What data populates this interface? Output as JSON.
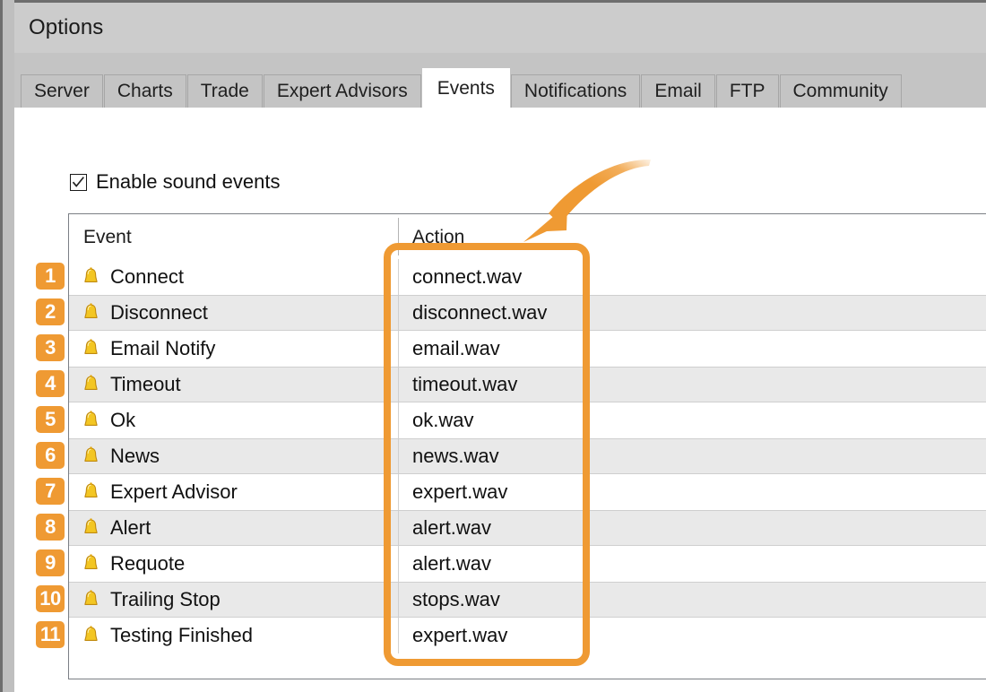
{
  "window": {
    "title": "Options"
  },
  "tabs": [
    {
      "label": "Server",
      "active": false
    },
    {
      "label": "Charts",
      "active": false
    },
    {
      "label": "Trade",
      "active": false
    },
    {
      "label": "Expert Advisors",
      "active": false
    },
    {
      "label": "Events",
      "active": true
    },
    {
      "label": "Notifications",
      "active": false
    },
    {
      "label": "Email",
      "active": false
    },
    {
      "label": "FTP",
      "active": false
    },
    {
      "label": "Community",
      "active": false
    }
  ],
  "events_page": {
    "enable_sound_events": {
      "label": "Enable sound events",
      "checked": true,
      "icon": "checkmark-icon"
    },
    "table": {
      "columns": [
        "Event",
        "Action"
      ],
      "rows": [
        {
          "num": "1",
          "icon": "bell-icon",
          "event": "Connect",
          "action": "connect.wav"
        },
        {
          "num": "2",
          "icon": "bell-icon",
          "event": "Disconnect",
          "action": "disconnect.wav"
        },
        {
          "num": "3",
          "icon": "bell-icon",
          "event": "Email Notify",
          "action": "email.wav"
        },
        {
          "num": "4",
          "icon": "bell-icon",
          "event": "Timeout",
          "action": "timeout.wav"
        },
        {
          "num": "5",
          "icon": "bell-icon",
          "event": "Ok",
          "action": "ok.wav"
        },
        {
          "num": "6",
          "icon": "bell-icon",
          "event": "News",
          "action": "news.wav"
        },
        {
          "num": "7",
          "icon": "bell-icon",
          "event": "Expert Advisor",
          "action": "expert.wav"
        },
        {
          "num": "8",
          "icon": "bell-icon",
          "event": "Alert",
          "action": "alert.wav"
        },
        {
          "num": "9",
          "icon": "bell-icon",
          "event": "Requote",
          "action": "alert.wav"
        },
        {
          "num": "10",
          "icon": "bell-icon",
          "event": "Trailing Stop",
          "action": "stops.wav"
        },
        {
          "num": "11",
          "icon": "bell-icon",
          "event": "Testing Finished",
          "action": "expert.wav"
        }
      ]
    }
  },
  "annotations": {
    "accent_color": "#ef9a33",
    "highlight_rect": {
      "target": "action-column"
    },
    "arrow": {
      "points_to": "action-column-top"
    }
  },
  "colors": {
    "accent": "#ef9a33",
    "titlebar": "#cccccc",
    "tabstrip": "#c4c4c4",
    "row_alt": "#e9e9e9",
    "text": "#111111",
    "bell": "#f5c518"
  }
}
